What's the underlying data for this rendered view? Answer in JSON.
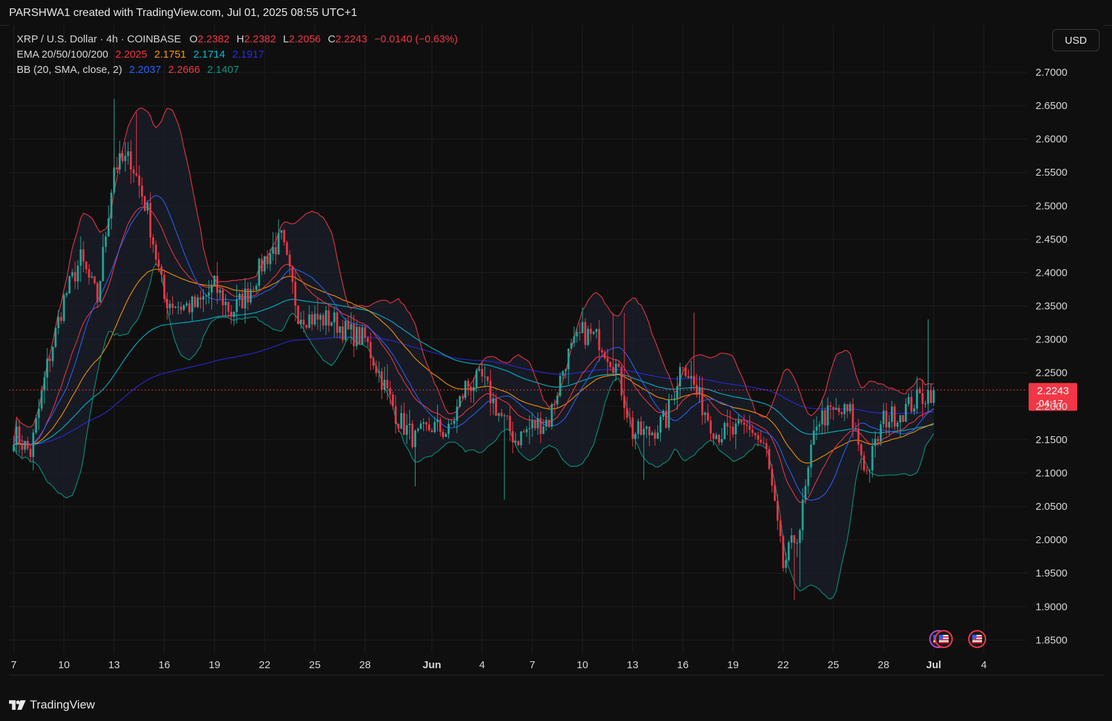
{
  "header": {
    "creator_line": "PARSHWA1 created with TradingView.com, Jul 01, 2025 08:55 UTC+1"
  },
  "legend": {
    "symbol": "XRP / U.S. Dollar · 4h · COINBASE",
    "ohlc": {
      "o_label": "O",
      "o": "2.2382",
      "h_label": "H",
      "h": "2.2382",
      "l_label": "L",
      "l": "2.2056",
      "c_label": "C",
      "c": "2.2243",
      "change": "−0.0140 (−0.63%)"
    },
    "ema_label": "EMA 20/50/100/200",
    "ema_values": [
      "2.2025",
      "2.1751",
      "2.1714",
      "2.1917"
    ],
    "bb_label": "BB (20, SMA, close, 2)",
    "bb_values": [
      "2.2037",
      "2.2666",
      "2.1407"
    ]
  },
  "currency_button": "USD",
  "price_tag": {
    "price": "2.2243",
    "countdown": "04:17"
  },
  "footer": {
    "brand": "TradingView"
  },
  "colors": {
    "up": "#26a69a",
    "down": "#f23645",
    "ema20": "#f23645",
    "ema50": "#ff9800",
    "ema100": "#00bcd4",
    "ema200": "#2a2ae6",
    "bb_basis": "#2962ff",
    "bb_upper": "#f23645",
    "bb_lower": "#089981",
    "band_fill": "#1b1f29"
  },
  "chart_data": {
    "type": "candlestick",
    "title": "XRP / U.S. Dollar · 4h · COINBASE",
    "x_tick_labels": [
      "7",
      "10",
      "13",
      "16",
      "19",
      "22",
      "25",
      "28",
      "Jun",
      "4",
      "7",
      "10",
      "13",
      "16",
      "19",
      "22",
      "25",
      "28",
      "Jul",
      "4"
    ],
    "y_tick_labels": [
      "2.7000",
      "2.6500",
      "2.6000",
      "2.5500",
      "2.5000",
      "2.4500",
      "2.4000",
      "2.3500",
      "2.3000",
      "2.2500",
      "2.2000",
      "2.1500",
      "2.1000",
      "2.0500",
      "2.0000",
      "1.9500",
      "1.9000",
      "1.8500"
    ],
    "ylim": [
      1.835,
      2.72
    ],
    "x_range_days": [
      "May 7 2025",
      "Jul 5 2025"
    ],
    "grid": true,
    "last_price": 2.2243,
    "price_key_points": [
      {
        "date": "May 7",
        "price": 2.16
      },
      {
        "date": "May 8",
        "price": 2.13
      },
      {
        "date": "May 9",
        "price": 2.26
      },
      {
        "date": "May 10",
        "price": 2.36
      },
      {
        "date": "May 11",
        "price": 2.42
      },
      {
        "date": "May 12",
        "price": 2.36
      },
      {
        "date": "May 13",
        "price": 2.56
      },
      {
        "date": "May 14",
        "price": 2.57
      },
      {
        "date": "May 15",
        "price": 2.49
      },
      {
        "date": "May 16",
        "price": 2.36
      },
      {
        "date": "May 17",
        "price": 2.35
      },
      {
        "date": "May 18",
        "price": 2.35
      },
      {
        "date": "May 19",
        "price": 2.38
      },
      {
        "date": "May 20",
        "price": 2.34
      },
      {
        "date": "May 21",
        "price": 2.37
      },
      {
        "date": "May 22",
        "price": 2.42
      },
      {
        "date": "May 23",
        "price": 2.45
      },
      {
        "date": "May 24",
        "price": 2.34
      },
      {
        "date": "May 25",
        "price": 2.33
      },
      {
        "date": "May 26",
        "price": 2.33
      },
      {
        "date": "May 27",
        "price": 2.31
      },
      {
        "date": "May 28",
        "price": 2.3
      },
      {
        "date": "May 29",
        "price": 2.24
      },
      {
        "date": "May 30",
        "price": 2.18
      },
      {
        "date": "May 31",
        "price": 2.15
      },
      {
        "date": "Jun 1",
        "price": 2.17
      },
      {
        "date": "Jun 2",
        "price": 2.16
      },
      {
        "date": "Jun 3",
        "price": 2.23
      },
      {
        "date": "Jun 4",
        "price": 2.24
      },
      {
        "date": "Jun 5",
        "price": 2.19
      },
      {
        "date": "Jun 6",
        "price": 2.15
      },
      {
        "date": "Jun 7",
        "price": 2.17
      },
      {
        "date": "Jun 8",
        "price": 2.18
      },
      {
        "date": "Jun 9",
        "price": 2.27
      },
      {
        "date": "Jun 10",
        "price": 2.31
      },
      {
        "date": "Jun 11",
        "price": 2.3
      },
      {
        "date": "Jun 12",
        "price": 2.26
      },
      {
        "date": "Jun 13",
        "price": 2.16
      },
      {
        "date": "Jun 14",
        "price": 2.16
      },
      {
        "date": "Jun 15",
        "price": 2.18
      },
      {
        "date": "Jun 16",
        "price": 2.27
      },
      {
        "date": "Jun 17",
        "price": 2.21
      },
      {
        "date": "Jun 18",
        "price": 2.16
      },
      {
        "date": "Jun 19",
        "price": 2.16
      },
      {
        "date": "Jun 20",
        "price": 2.17
      },
      {
        "date": "Jun 21",
        "price": 2.13
      },
      {
        "date": "Jun 22",
        "price": 1.96
      },
      {
        "date": "Jun 23",
        "price": 2.02
      },
      {
        "date": "Jun 24",
        "price": 2.18
      },
      {
        "date": "Jun 25",
        "price": 2.19
      },
      {
        "date": "Jun 26",
        "price": 2.19
      },
      {
        "date": "Jun 27",
        "price": 2.1
      },
      {
        "date": "Jun 28",
        "price": 2.18
      },
      {
        "date": "Jun 29",
        "price": 2.19
      },
      {
        "date": "Jun 30",
        "price": 2.21
      },
      {
        "date": "Jul 1",
        "price": 2.2243
      }
    ],
    "series": [
      {
        "name": "EMA 20",
        "last": 2.2025
      },
      {
        "name": "EMA 50",
        "last": 2.1751
      },
      {
        "name": "EMA 100",
        "last": 2.1714
      },
      {
        "name": "EMA 200",
        "last": 2.1917
      },
      {
        "name": "BB basis",
        "last": 2.2037
      },
      {
        "name": "BB upper",
        "last": 2.2666
      },
      {
        "name": "BB lower",
        "last": 2.1407
      }
    ]
  }
}
